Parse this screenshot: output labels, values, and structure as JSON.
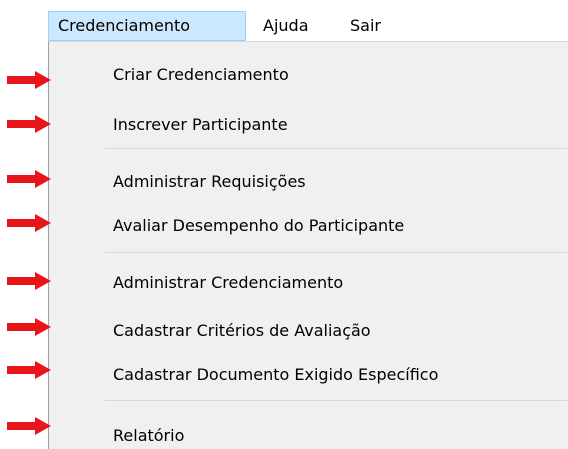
{
  "menubar": {
    "items": [
      {
        "label": "Credenciamento"
      },
      {
        "label": "Ajuda"
      },
      {
        "label": "Sair"
      }
    ]
  },
  "dropdown": {
    "items": [
      {
        "label": "Criar Credenciamento"
      },
      {
        "label": "Inscrever Participante"
      },
      {
        "label": "Administrar Requisições"
      },
      {
        "label": "Avaliar Desempenho do Participante"
      },
      {
        "label": "Administrar Credenciamento"
      },
      {
        "label": "Cadastrar Critérios de Avaliação"
      },
      {
        "label": "Cadastrar Documento Exigido Específico"
      },
      {
        "label": "Relatório"
      }
    ]
  },
  "colors": {
    "arrow": "#e8161b",
    "active_menu_bg": "#cce8ff",
    "dropdown_bg": "#f0f0f0"
  }
}
